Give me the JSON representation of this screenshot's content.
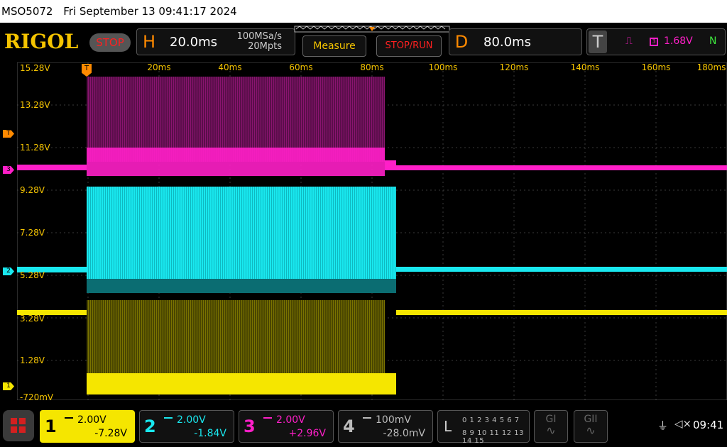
{
  "titlebar": {
    "model": "MSO5072",
    "datetime": "Fri September 13 09:41:17 2024"
  },
  "topbar": {
    "logo": "RIGOL",
    "run_state": "STOP",
    "horizontal": {
      "letter": "H",
      "timebase": "20.0ms",
      "sample_rate": "100MSa/s",
      "memory_depth": "20Mpts"
    },
    "measure_label": "Measure",
    "stoprun_label": "STOP/RUN",
    "delay": {
      "letter": "D",
      "value": "80.0ms"
    },
    "trigger": {
      "letter": "T",
      "source": "3",
      "level": "1.68V",
      "mode": "N"
    }
  },
  "screen": {
    "x_labels": [
      "20ms",
      "40ms",
      "60ms",
      "80ms",
      "100ms",
      "120ms",
      "140ms",
      "160ms",
      "180ms"
    ],
    "y_labels": [
      "15.28V",
      "13.28V",
      "11.28V",
      "9.28V",
      "7.28V",
      "5.28V",
      "3.28V",
      "1.28V",
      "-720mV"
    ],
    "markers": {
      "trigger_level": "T",
      "ch3": "3",
      "ch2": "2",
      "ch1": "1",
      "trigger_position": "T"
    },
    "colors": {
      "ch1": "#f5e600",
      "ch2": "#19e8ef",
      "ch3": "#ff1fc8",
      "accent": "#ff8a00",
      "labels": "#f5c400",
      "grid": "#3a3a3a"
    }
  },
  "channels": [
    {
      "num": "1",
      "scale": "2.00V",
      "offset": "-7.28V",
      "color": "#f5e600"
    },
    {
      "num": "2",
      "scale": "2.00V",
      "offset": "-1.84V",
      "color": "#19e8ef"
    },
    {
      "num": "3",
      "scale": "2.00V",
      "offset": "+2.96V",
      "color": "#ff1fc8"
    },
    {
      "num": "4",
      "scale": "100mV",
      "offset": "-28.0mV",
      "color": "#bbbbbb"
    }
  ],
  "logic": {
    "label": "L",
    "bits_row1": "0 1 2 3   4 5 6 7",
    "bits_row2": "8 9 10 11 12 13 14 15"
  },
  "bottom": {
    "g1_label": "GI",
    "g2_label": "GII",
    "clock": "09:41"
  }
}
